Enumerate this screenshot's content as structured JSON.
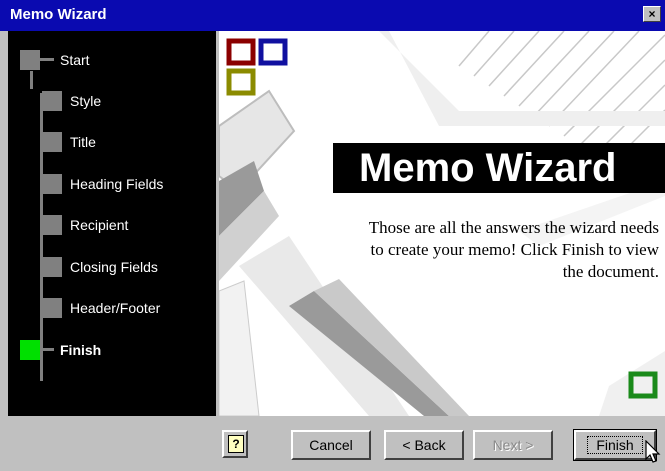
{
  "window": {
    "title": "Memo Wizard",
    "close_glyph": "×"
  },
  "steps": [
    {
      "label": "Start",
      "state": "done"
    },
    {
      "label": "Style",
      "state": "pending"
    },
    {
      "label": "Title",
      "state": "pending"
    },
    {
      "label": "Heading Fields",
      "state": "pending"
    },
    {
      "label": "Recipient",
      "state": "pending"
    },
    {
      "label": "Closing Fields",
      "state": "pending"
    },
    {
      "label": "Header/Footer",
      "state": "pending"
    },
    {
      "label": "Finish",
      "state": "current"
    }
  ],
  "main": {
    "heading": "Memo Wizard",
    "description": "Those are all the answers the wizard needs to create your memo!  Click Finish to view the document."
  },
  "buttons": {
    "help_glyph": "?",
    "cancel": "Cancel",
    "back": "< Back",
    "next": "Next >",
    "finish": "Finish"
  },
  "colors": {
    "title_bar": "#0a0ab0",
    "sidebar_bg": "#000000",
    "current_step": "#00e000",
    "step_node": "#808080",
    "square_red": "#8b0000",
    "square_blue": "#1010a0",
    "square_olive": "#8b8b00",
    "square_green": "#1a8a1a"
  }
}
